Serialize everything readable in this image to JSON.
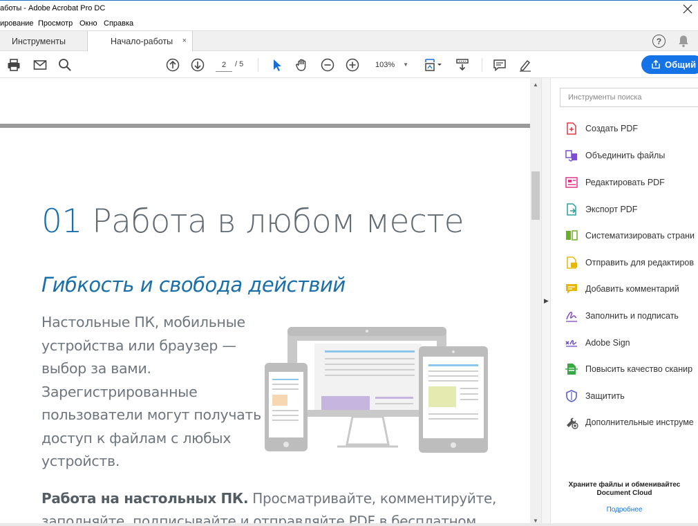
{
  "window": {
    "title": "аботы - Adobe Acrobat Pro DC"
  },
  "menu": {
    "items": [
      "ирование",
      "Просмотр",
      "Окно",
      "Справка"
    ]
  },
  "tabs": {
    "tools": "Инструменты",
    "document": "Начало-работы",
    "close": "×"
  },
  "toolbar": {
    "current_page": "2",
    "total_pages": "/ 5",
    "zoom": "103%",
    "share_label": "Общий"
  },
  "document": {
    "heading_number": "01",
    "heading_text": "Работа в любом месте",
    "subheading": "Гибкость и свобода действий",
    "paragraph": "Настольные ПК, мобильные устройства или браузер — выбор за вами. Зарегистрированные пользователи могут получать доступ к файлам с любых устройств.",
    "paragraph2_bold": "Работа на настольных ПК.",
    "paragraph2_text": " Просматривайте, комментируйте, заполняйте, подписывайте и отправляйте PDF в бесплатном"
  },
  "panel": {
    "search_placeholder": "Инструменты поиска",
    "tools": [
      {
        "label": "Создать PDF",
        "icon": "create-pdf-icon",
        "color": "#e0383e"
      },
      {
        "label": "Объединить файлы",
        "icon": "combine-files-icon",
        "color": "#7a4fd6"
      },
      {
        "label": "Редактировать PDF",
        "icon": "edit-pdf-icon",
        "color": "#e0358a"
      },
      {
        "label": "Экспорт PDF",
        "icon": "export-pdf-icon",
        "color": "#2aa198"
      },
      {
        "label": "Систематизировать страни",
        "icon": "organize-pages-icon",
        "color": "#6ab023"
      },
      {
        "label": "Отправить для редактиров",
        "icon": "send-for-review-icon",
        "color": "#e5b80b"
      },
      {
        "label": "Добавить комментарий",
        "icon": "comment-icon",
        "color": "#e5b80b"
      },
      {
        "label": "Заполнить и подписать",
        "icon": "fill-sign-icon",
        "color": "#8a55c8"
      },
      {
        "label": "Adobe Sign",
        "icon": "adobe-sign-icon",
        "color": "#6b4ac9"
      },
      {
        "label": "Повысить качество сканир",
        "icon": "enhance-scan-icon",
        "color": "#3aa845"
      },
      {
        "label": "Защитить",
        "icon": "protect-icon",
        "color": "#5b5fc7"
      },
      {
        "label": "Дополнительные инструме",
        "icon": "more-tools-icon",
        "color": "#555555"
      }
    ],
    "promo_line1": "Храните файлы и обменивайтес",
    "promo_line2": "Document Cloud",
    "promo_link": "Подробнее"
  },
  "colors": {
    "accent": "#1473e6",
    "heading_blue": "#1a6fa8",
    "body_gray": "#6d767e"
  }
}
